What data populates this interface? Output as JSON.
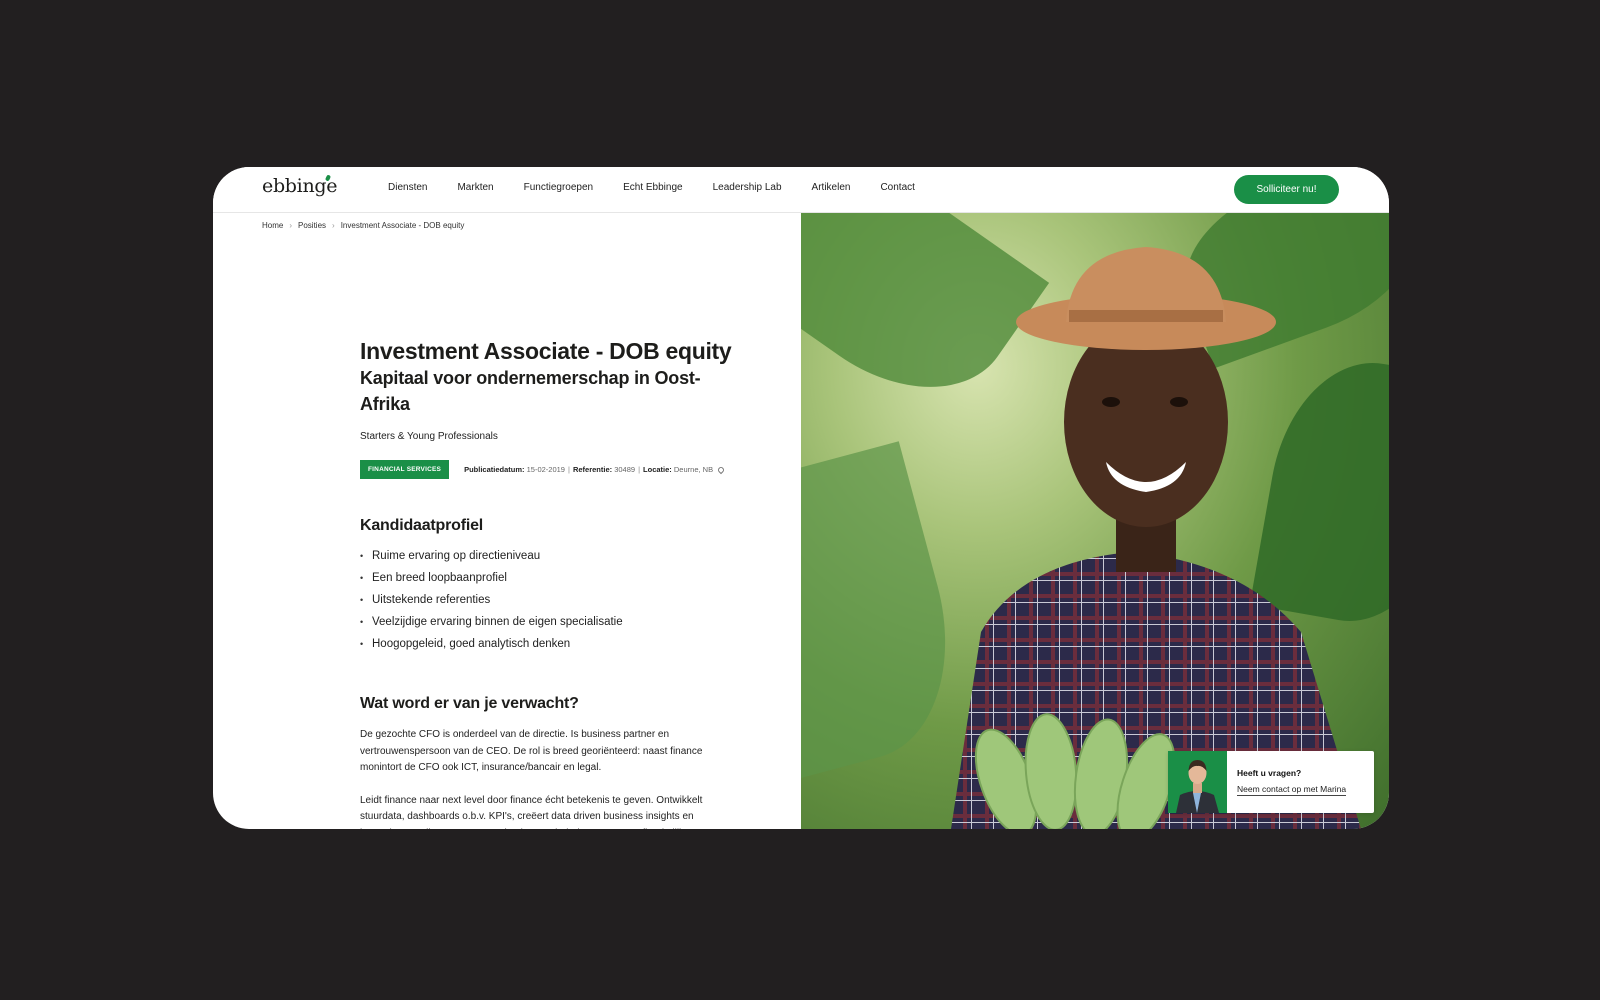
{
  "header": {
    "logo": "ebbinge",
    "nav": [
      "Diensten",
      "Markten",
      "Functiegroepen",
      "Echt Ebbinge",
      "Leadership Lab",
      "Artikelen",
      "Contact"
    ],
    "cta_label": "Solliciteer nu!"
  },
  "breadcrumb": {
    "home": "Home",
    "posities": "Posities",
    "current": "Investment Associate - DOB equity"
  },
  "job": {
    "title": "Investment Associate - DOB equity",
    "subtitle": "Kapitaal voor ondernemerschap in Oost-Afrika",
    "category": "Starters & Young Professionals",
    "badge": "FINANCIAL SERVICES",
    "meta": {
      "pub_label": "Publicatiedatum:",
      "pub_value": "15-02-2019",
      "ref_label": "Referentie:",
      "ref_value": "30489",
      "loc_label": "Locatie:",
      "loc_value": "Deurne, NB"
    }
  },
  "profile": {
    "heading": "Kandidaatprofiel",
    "items": [
      "Ruime ervaring op directieniveau",
      "Een breed loopbaanprofiel",
      "Uitstekende referenties",
      "Veelzijdige ervaring binnen de eigen specialisatie",
      "Hoogopgeleid, goed analytisch denken"
    ]
  },
  "expect": {
    "heading": "Wat word er van je verwacht?",
    "para1": "De gezochte CFO is onderdeel van de directie. Is business partner en vertrouwenspersoon van de CEO. De rol is breed georiënteerd: naast finance monintort de CFO ook ICT, insurance/bancair en legal.",
    "para2": "Leidt finance naar next level door finance écht betekenis te geven. Ontwikkelt stuurdata, dashboards o.b.v. KPI's, creëert data driven business insights en kostenbewustzijn. Voor ervaren, business minded CFO met onafhankelijke, "
  },
  "contact": {
    "question": "Heeft u vragen?",
    "link": "Neem contact op met Marina"
  },
  "colors": {
    "brand_green": "#1a8f47",
    "background": "#221f20"
  }
}
